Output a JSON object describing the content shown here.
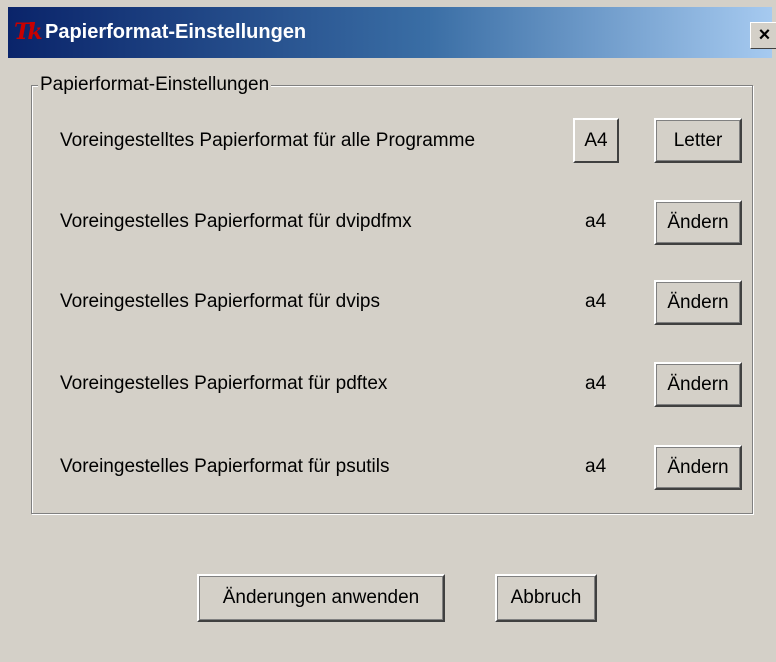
{
  "window": {
    "title": "Papierformat-Einstellungen",
    "close_label": "×",
    "icon_text": "Tk"
  },
  "group": {
    "legend": "Papierformat-Einstellungen"
  },
  "default_row": {
    "label": "Voreingestelltes Papierformat für alle Programme",
    "option_a4": "A4",
    "option_letter": "Letter"
  },
  "rows": [
    {
      "label": "Voreingestelles Papierformat für dvipdfmx",
      "value": "a4",
      "button": "Ändern"
    },
    {
      "label": "Voreingestelles Papierformat für dvips",
      "value": "a4",
      "button": "Ändern"
    },
    {
      "label": "Voreingestelles Papierformat für pdftex",
      "value": "a4",
      "button": "Ändern"
    },
    {
      "label": "Voreingestelles Papierformat für psutils",
      "value": "a4",
      "button": "Ändern"
    }
  ],
  "footer": {
    "apply_label": "Änderungen anwenden",
    "cancel_label": "Abbruch"
  }
}
